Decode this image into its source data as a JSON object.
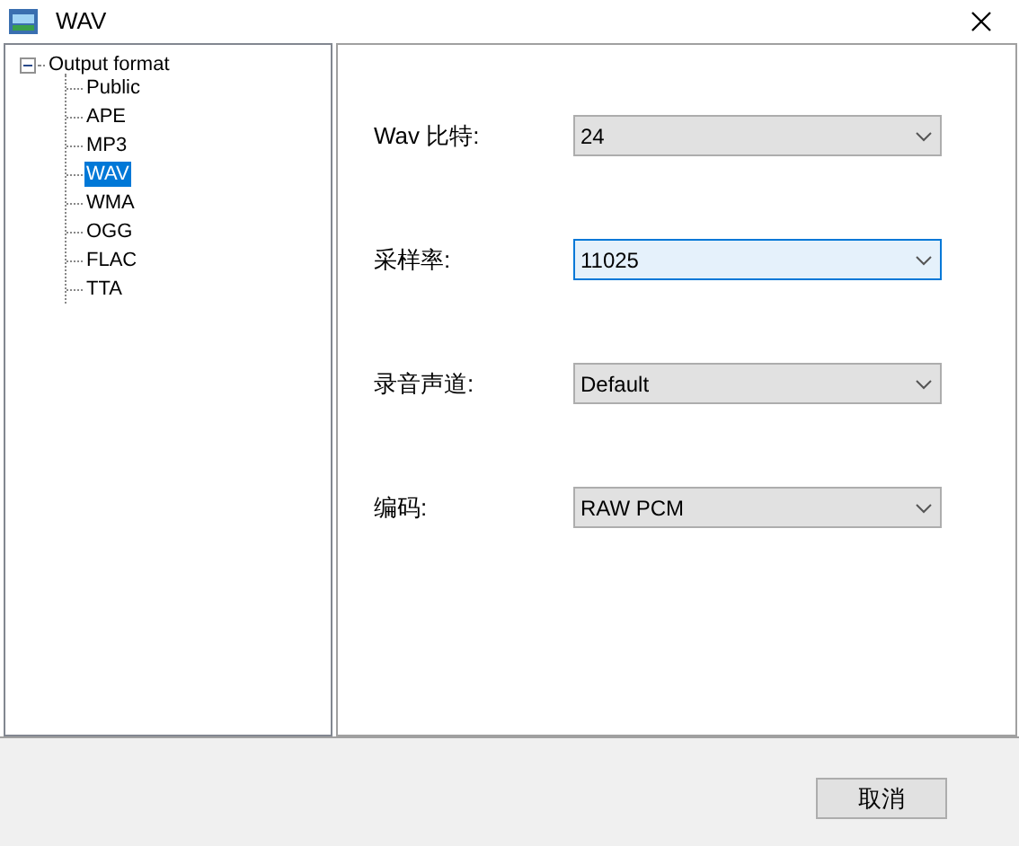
{
  "window": {
    "title": "WAV"
  },
  "tree": {
    "label": "Output format",
    "expanded": true,
    "children": [
      {
        "label": "Public",
        "selected": false
      },
      {
        "label": "APE",
        "selected": false
      },
      {
        "label": "MP3",
        "selected": false
      },
      {
        "label": "WAV",
        "selected": true
      },
      {
        "label": "WMA",
        "selected": false
      },
      {
        "label": "OGG",
        "selected": false
      },
      {
        "label": "FLAC",
        "selected": false
      },
      {
        "label": "TTA",
        "selected": false
      }
    ]
  },
  "fields": [
    {
      "label": "Wav 比特:",
      "value": "24",
      "focused": false
    },
    {
      "label": "采样率:",
      "value": "11025",
      "focused": true
    },
    {
      "label": "录音声道:",
      "value": "Default",
      "focused": false
    },
    {
      "label": "编码:",
      "value": "RAW PCM",
      "focused": false
    }
  ],
  "buttons": [
    "取消"
  ]
}
